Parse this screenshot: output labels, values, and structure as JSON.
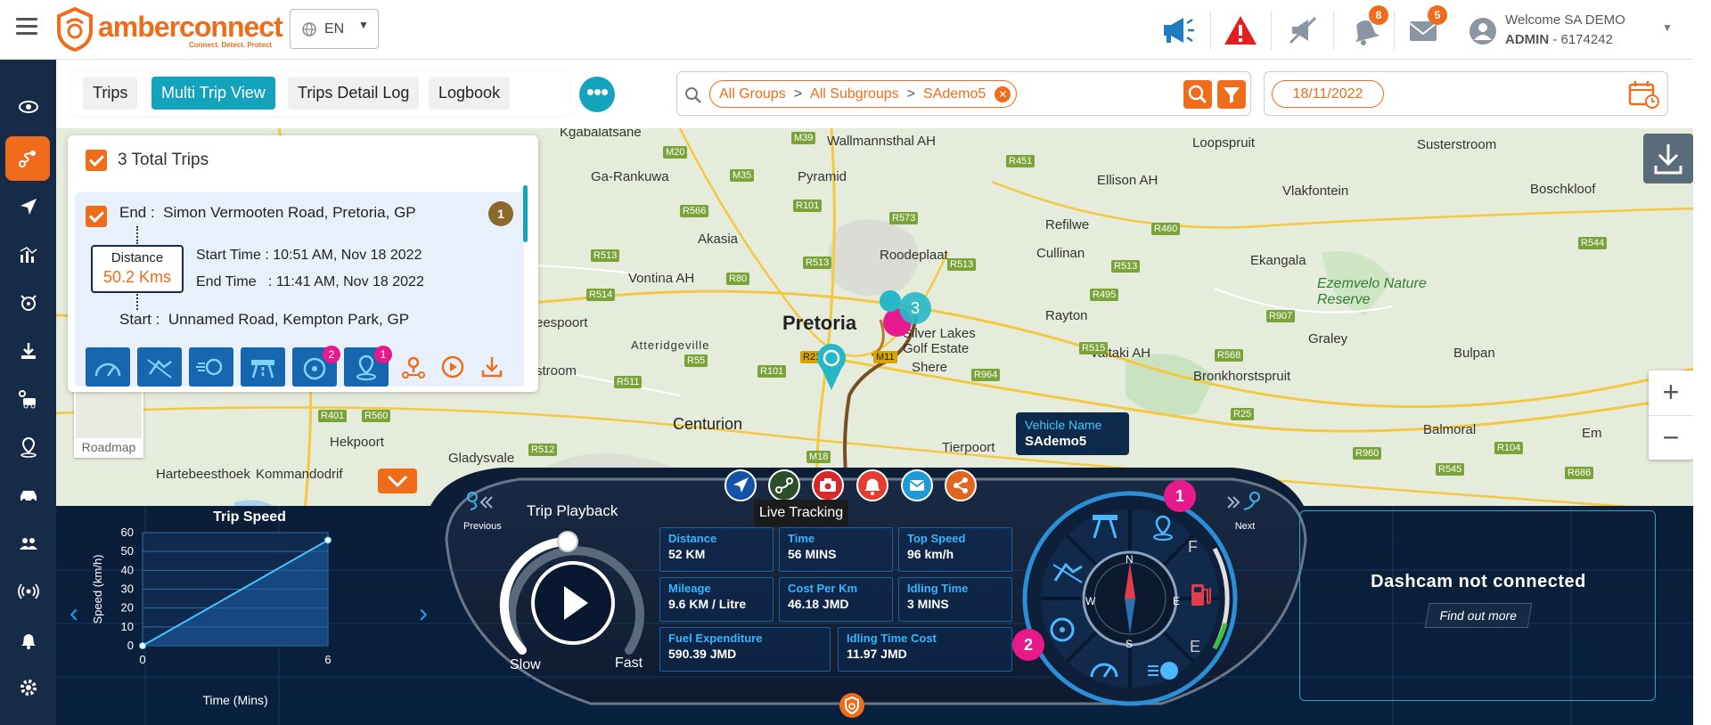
{
  "header": {
    "brand": "amberconnect",
    "brand_tagline": "Connect. Detect. Protect",
    "language": "EN",
    "notifications_count": "8",
    "messages_count": "5",
    "welcome": "Welcome SA DEMO",
    "role": "ADMIN",
    "account": " - 6174242"
  },
  "tabs": [
    {
      "label": "Trips",
      "active": false
    },
    {
      "label": "Multi Trip View",
      "active": true
    },
    {
      "label": "Trips Detail Log",
      "active": false
    },
    {
      "label": "Logbook",
      "active": false
    }
  ],
  "filters": {
    "group": "All Groups",
    "subgroup": "All Subgroups",
    "vehicle": "SAdemo5",
    "separator": ">",
    "date": "18/11/2022"
  },
  "trip_list": {
    "total_label": "3 Total Trips",
    "trip": {
      "number": "1",
      "end_label": "End :",
      "end_address": "Simon Vermooten Road, Pretoria, GP",
      "start_label": "Start :",
      "start_address": "Unnamed Road, Kempton Park, GP",
      "distance_label": "Distance",
      "distance_value": "50.2 Kms",
      "start_time": "Start Time : 10:51 AM, Nov 18 2022",
      "end_time": "End Time   : 11:41 AM, Nov 18 2022",
      "badges": {
        "fleet": "2",
        "location": "1"
      }
    }
  },
  "map": {
    "roadmap_label": "Roadmap",
    "vehicle_name_label": "Vehicle Name",
    "vehicle_name": "SAdemo5",
    "cluster_count": "3",
    "places": [
      "Kgabalatsane",
      "Wallmannsthal AH",
      "Loopspruit",
      "Susterstroom",
      "Ga-Rankuwa",
      "Pyramid",
      "Ellison AH",
      "Vlakfontein",
      "Boschkloof",
      "Akasia",
      "Refilwe",
      "Roodeplaat",
      "Cullinan",
      "Ekangala",
      "Vontina AH",
      "Pretoria",
      "Rayton",
      "Ezemvelo Nature Reserve",
      "Silver Lakes Golf Estate",
      "Graley",
      "Bulpan",
      "eespoort",
      "Atteridgeville",
      "Shere",
      "Valtaki AH",
      "Bronkhorstspruit",
      "stroom",
      "Centurion",
      "Hekpoort",
      "Gladysvale",
      "Tierpoort",
      "Balmoral",
      "Em",
      "Hartebeesthoek",
      "Kommandodrif"
    ],
    "roads": [
      "M39",
      "M20",
      "R566",
      "R101",
      "M35",
      "R451",
      "R513",
      "R80",
      "R573",
      "R513",
      "R514",
      "R55",
      "R21",
      "M11",
      "R515",
      "R568",
      "R907",
      "R544",
      "R511",
      "R101",
      "R964",
      "R25",
      "R460",
      "R104",
      "R401",
      "R560",
      "R512",
      "M18",
      "R686",
      "R545",
      "R960",
      "R513",
      "R495",
      "R513"
    ]
  },
  "dashboard": {
    "trip_speed_title": "Trip Speed",
    "playback_title": "Trip Playback",
    "previous": "Previous",
    "next": "Next",
    "slow": "Slow",
    "fast": "Fast",
    "live_tracking": "Live Tracking",
    "stats": [
      {
        "label": "Distance",
        "value": "52 KM"
      },
      {
        "label": "Time",
        "value": "56 MINS"
      },
      {
        "label": "Top Speed",
        "value": "96 km/h"
      },
      {
        "label": "Mileage",
        "value": "9.6 KM / Litre"
      },
      {
        "label": "Cost Per Km",
        "value": "46.18 JMD"
      },
      {
        "label": "Idling Time",
        "value": "3 MINS"
      },
      {
        "label": "Fuel Expenditure",
        "value": "590.39 JMD"
      },
      {
        "label": "Idling Time Cost",
        "value": "11.97 JMD"
      }
    ],
    "gauge_badges": [
      "1",
      "2"
    ],
    "compass": [
      "N",
      "E",
      "S",
      "W"
    ],
    "fuel_marks": [
      "F",
      "E"
    ],
    "dashcam_title": "Dashcam not connected",
    "find_out_more": "Find out more",
    "accent": "#14a3bd",
    "brand_orange": "#ef6c1a"
  },
  "chart_data": {
    "type": "line",
    "title": "Trip Speed",
    "xlabel": "Time (Mins)",
    "ylabel": "Speed (km/h)",
    "x": [
      0,
      6
    ],
    "y": [
      0,
      56
    ],
    "xlim": [
      0,
      6
    ],
    "ylim": [
      0,
      60
    ],
    "yticks": [
      0,
      10,
      20,
      30,
      40,
      50,
      60
    ],
    "xticks": [
      0,
      6
    ],
    "grid": true
  }
}
